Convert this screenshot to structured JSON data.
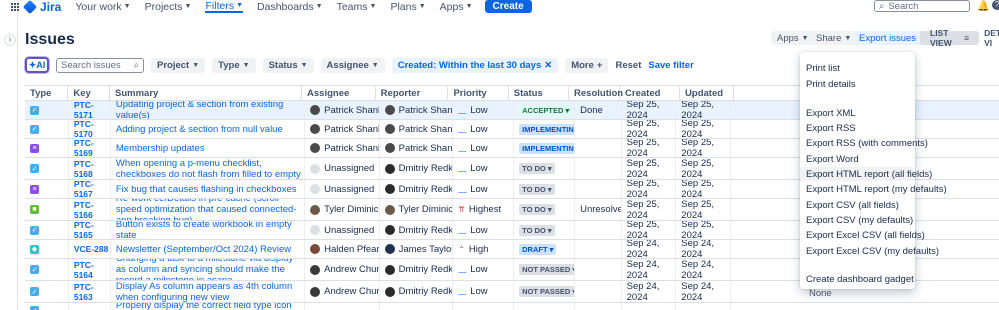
{
  "nav": {
    "logo": "Jira",
    "items": [
      "Your work",
      "Projects",
      "Filters",
      "Dashboards",
      "Teams",
      "Plans",
      "Apps"
    ],
    "create": "Create",
    "search_placeholder": "Search"
  },
  "page": {
    "title": "Issues",
    "apps": "Apps",
    "share": "Share",
    "export": "Export issues",
    "list_view": "LIST VIEW",
    "detail_view": "DETAIL VI"
  },
  "filters": {
    "ai": "AI",
    "search_placeholder": "Search issues",
    "project": "Project",
    "type": "Type",
    "status": "Status",
    "assignee": "Assignee",
    "created": "Created: Within the last 30 days",
    "more": "More",
    "reset": "Reset",
    "save": "Save filter"
  },
  "columns": [
    "Type",
    "Key",
    "Summary",
    "Assignee",
    "Reporter",
    "Priority",
    "Status",
    "Resolution",
    "Created",
    "Updated"
  ],
  "rows": [
    {
      "type_color": "#4bade8",
      "type_glyph": "✓",
      "key": "PTC-5171",
      "summary": "Updating project & section from existing value(s)",
      "assignee": "Patrick Shanley",
      "reporter": "Patrick Shanley",
      "priority": "Low",
      "status": "ACCEPTED",
      "status_kind": "green",
      "resolution": "Done",
      "created": "Sep 25, 2024",
      "updated": "Sep 25, 2024",
      "selected": true
    },
    {
      "type_color": "#4bade8",
      "type_glyph": "✓",
      "key": "PTC-5170",
      "summary": "Adding project & section from null value",
      "assignee": "Patrick Shanley",
      "reporter": "Patrick Shanley",
      "priority": "Low",
      "status": "IMPLEMENTING",
      "status_kind": "blue",
      "resolution": "",
      "created": "Sep 25, 2024",
      "updated": "Sep 25, 2024"
    },
    {
      "type_color": "#904ee2",
      "type_glyph": "≡",
      "key": "PTC-5169",
      "summary": "Membership updates",
      "assignee": "Patrick Shanley",
      "reporter": "Patrick Shanley",
      "priority": "Low",
      "status": "IMPLEMENTING",
      "status_kind": "blue",
      "resolution": "",
      "created": "Sep 25, 2024",
      "updated": "Sep 25, 2024"
    },
    {
      "type_color": "#4bade8",
      "type_glyph": "✓",
      "key": "PTC-5168",
      "summary": "When opening a p-menu checklist, checkboxes do not flash from filled to empty",
      "assignee": "Unassigned",
      "reporter": "Dmitriy Redkin",
      "priority": "Low",
      "status": "TO DO",
      "status_kind": "grey",
      "resolution": "",
      "created": "Sep 25, 2024",
      "updated": "Sep 25, 2024"
    },
    {
      "type_color": "#904ee2",
      "type_glyph": "≡",
      "key": "PTC-5167",
      "summary": "Fix bug that causes flashing in checkboxes",
      "assignee": "Unassigned",
      "reporter": "Dmitriy Redkin",
      "priority": "Low",
      "status": "TO DO",
      "status_kind": "grey",
      "resolution": "",
      "created": "Sep 25, 2024",
      "updated": "Sep 25, 2024"
    },
    {
      "type_color": "#63ba3c",
      "type_glyph": "■",
      "key": "PTC-5166",
      "summary": "Re-work eefDetails in pre-cache (scroll speed optimization that caused connected-app breaking bug)",
      "assignee": "Tyler Diminick",
      "reporter": "Tyler Diminick",
      "priority": "Highest",
      "status": "TO DO",
      "status_kind": "grey",
      "resolution": "Unresolved",
      "created": "Sep 25, 2024",
      "updated": "Sep 25, 2024"
    },
    {
      "type_color": "#4bade8",
      "type_glyph": "✓",
      "key": "PTC-5165",
      "summary": "Button exists to create workbook in empty state",
      "assignee": "Unassigned",
      "reporter": "Dmitriy Redkin",
      "priority": "Low",
      "status": "TO DO",
      "status_kind": "grey",
      "resolution": "",
      "created": "Sep 25, 2024",
      "updated": "Sep 25, 2024"
    },
    {
      "type_color": "#2ec4c4",
      "type_glyph": "◆",
      "key": "VCE-288",
      "summary": "Newsletter (September/Oct 2024) Review",
      "assignee": "Halden Pfearsen",
      "reporter": "James Taylor",
      "priority": "High",
      "status": "DRAFT",
      "status_kind": "blue",
      "resolution": "",
      "created": "Sep 24, 2024",
      "updated": "Sep 24, 2024"
    },
    {
      "type_color": "#4bade8",
      "type_glyph": "✓",
      "key": "PTC-5164",
      "summary": "Changing a task to a milestone via display as column and syncing should make the record a milestone in asana",
      "assignee": "Andrew Chung",
      "reporter": "Dmitriy Redkin",
      "priority": "Low",
      "status": "NOT PASSED",
      "status_kind": "grey",
      "resolution": "",
      "created": "Sep 24, 2024",
      "updated": "Sep 24, 2024"
    },
    {
      "type_color": "#4bade8",
      "type_glyph": "✓",
      "key": "PTC-5163",
      "summary": "Display As column appears as 4th column when configuring new view",
      "assignee": "Andrew Chung",
      "reporter": "Dmitriy Redkin",
      "priority": "Low",
      "status": "NOT PASSED",
      "status_kind": "grey",
      "resolution": "",
      "created": "Sep 24, 2024",
      "updated": "Sep 24, 2024"
    },
    {
      "type_color": "#4bade8",
      "type_glyph": "✓",
      "key": "",
      "summary": "Properly display the correct field type icon for asana fields",
      "assignee": "",
      "reporter": "",
      "priority": "",
      "status": "",
      "status_kind": "grey",
      "resolution": "",
      "created": "",
      "updated": ""
    }
  ],
  "export_menu": {
    "items": [
      "Print list",
      "Print details",
      "Export XML",
      "Export RSS",
      "Export RSS (with comments)",
      "Export Word",
      "Export HTML report (all fields)",
      "Export HTML report (my defaults)",
      "Export CSV (all fields)",
      "Export CSV (my defaults)",
      "Export Excel CSV (all fields)",
      "Export Excel CSV (my defaults)",
      "Create dashboard gadget"
    ],
    "highlighted": "Export HTML report (all fields)"
  },
  "peek_cell": "None",
  "colors": {
    "accent": "#0c66e4",
    "ai_border": "#6554c0"
  }
}
